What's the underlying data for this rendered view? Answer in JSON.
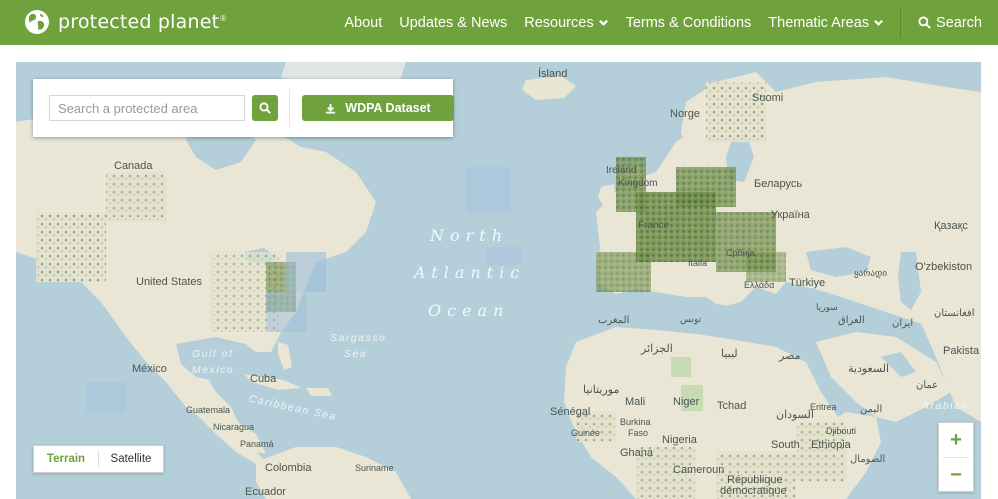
{
  "header": {
    "logo_text": "protected planet",
    "logo_mark": "®",
    "nav": [
      {
        "label": "About",
        "dropdown": false
      },
      {
        "label": "Updates & News",
        "dropdown": false
      },
      {
        "label": "Resources",
        "dropdown": true
      },
      {
        "label": "Terms & Conditions",
        "dropdown": false
      },
      {
        "label": "Thematic Areas",
        "dropdown": true
      }
    ],
    "search_label": "Search",
    "bg_color": "#6fa13d"
  },
  "search_panel": {
    "placeholder": "Search a protected area",
    "wdpa_label": "WDPA Dataset"
  },
  "map": {
    "oceans": {
      "line1": "North",
      "line2": "Atlantic",
      "line3": "Ocean"
    },
    "seas": {
      "sargasso1": "Sargasso",
      "sargasso2": "Sea",
      "gulf1": "Gulf of",
      "gulf2": "Mexico",
      "caribbean": "Caribbean Sea",
      "arabian": "Arabian"
    },
    "labels": {
      "island": "Ísland",
      "norge": "Norge",
      "suomi": "Suomi",
      "canada": "Canada",
      "us": "United States",
      "mexico": "México",
      "cuba": "Cuba",
      "guatemala": "Guatemala",
      "nicaragua": "Nicaragua",
      "panama": "Panamá",
      "colombia": "Colombia",
      "suriname": "Suriname",
      "ecuador": "Ecuador",
      "ireland": "Ireland",
      "uk": "Kingdom",
      "france": "France",
      "belarus": "Беларусь",
      "ukraina": "Україна",
      "kazakh": "Қазақс",
      "uzbek": "O'zbekiston",
      "turkiye": "Türkiye",
      "pakistan": "Pakista",
      "cezayir": "الجزائر",
      "libya": "ليبيا",
      "egypt": "مصر",
      "morocco": "المغرب",
      "mauritanie": "موريتانيا",
      "mali": "Mali",
      "niger": "Niger",
      "tchad": "Tchad",
      "sudan": "السودان",
      "eritrea": "Eritrea",
      "yemen": "اليمن",
      "djibouti": "Djibouti",
      "south": "South",
      "ethiopia": "Ethiopia",
      "somalia": "الصومال",
      "senegal": "Sénégal",
      "guinee": "Guinée",
      "burkina": "Burkina",
      "faso": "Faso",
      "nigeria": "Nigeria",
      "ghana": "Ghana",
      "cameroun": "Cameroun",
      "republique": "République",
      "democratique": "démocratique",
      "saudi": "السعودية",
      "iran": "ایران",
      "iraq": "العراق",
      "syria": "سوريا",
      "afghan": "افغانستان",
      "oman": "عمان",
      "sudan2": "السودان",
      "italia": "Italia",
      "srbija": "Србија",
      "greece": "Ελλάδα",
      "tunisia": "تونس",
      "georgia": "ყარადი"
    }
  },
  "layer_toggle": {
    "terrain": "Terrain",
    "satellite": "Satellite",
    "active": "terrain"
  },
  "zoom": {
    "in": "+",
    "out": "−"
  },
  "colors": {
    "accent": "#6fa13d",
    "ocean": "#b4cfd9",
    "land": "#e9e6d5",
    "protected": "#52752c"
  }
}
